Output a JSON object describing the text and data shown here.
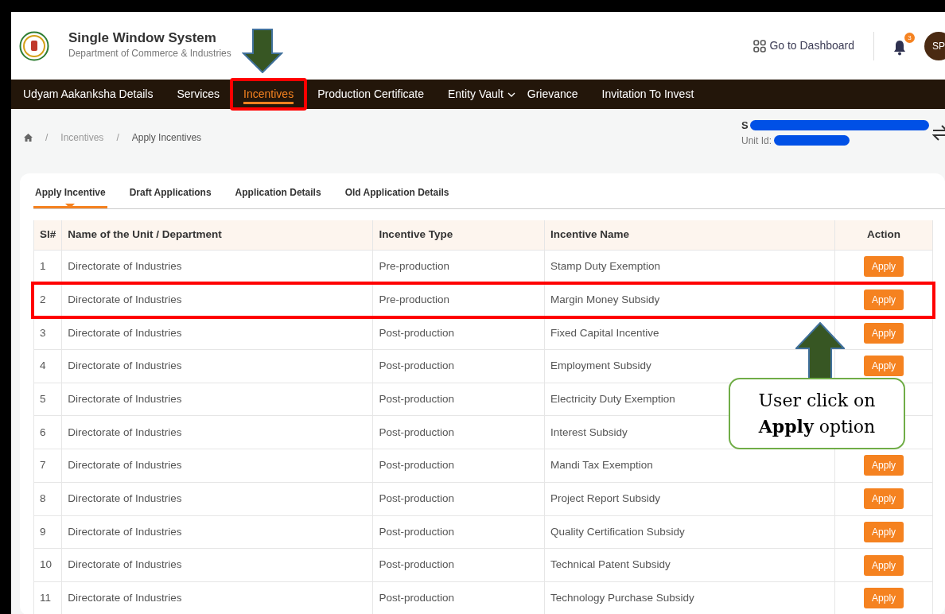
{
  "header": {
    "title": "Single Window System",
    "subtitle": "Department of Commerce & Industries",
    "dashboard_link": "Go to Dashboard",
    "notification_count": "3",
    "avatar": "SP"
  },
  "nav": [
    {
      "label": "Udyam Aakanksha Details",
      "selected": false,
      "highlighted": false,
      "dropdown": false
    },
    {
      "label": "Services",
      "selected": false,
      "highlighted": false,
      "dropdown": false
    },
    {
      "label": "Incentives",
      "selected": true,
      "highlighted": true,
      "dropdown": false
    },
    {
      "label": "Production Certificate",
      "selected": false,
      "highlighted": false,
      "dropdown": false
    },
    {
      "label": "Entity Vault",
      "selected": false,
      "highlighted": false,
      "dropdown": true
    },
    {
      "label": "Grievance",
      "selected": false,
      "highlighted": false,
      "dropdown": false
    },
    {
      "label": "Invitation To Invest",
      "selected": false,
      "highlighted": false,
      "dropdown": false
    }
  ],
  "breadcrumb": [
    {
      "separator": "/",
      "label": "Incentives"
    },
    {
      "separator": "/",
      "label": "Apply Incentives"
    }
  ],
  "unit": {
    "name": "S",
    "id_label": "Unit Id:"
  },
  "tabs": [
    {
      "label": "Apply Incentive",
      "selected": true
    },
    {
      "label": "Draft Applications",
      "selected": false
    },
    {
      "label": "Application Details",
      "selected": false
    },
    {
      "label": "Old Application Details",
      "selected": false
    }
  ],
  "table": {
    "columns": [
      "Sl#",
      "Name of the Unit / Department",
      "Incentive Type",
      "Incentive Name",
      "Action"
    ],
    "rows": [
      {
        "sl": "1",
        "unit": "Directorate of Industries",
        "type": "Pre-production",
        "name": "Stamp Duty Exemption",
        "action": "Apply",
        "highlighted": false
      },
      {
        "sl": "2",
        "unit": "Directorate of Industries",
        "type": "Pre-production",
        "name": "Margin Money Subsidy",
        "action": "Apply",
        "highlighted": true
      },
      {
        "sl": "3",
        "unit": "Directorate of Industries",
        "type": "Post-production",
        "name": "Fixed Capital Incentive",
        "action": "Apply",
        "highlighted": false
      },
      {
        "sl": "4",
        "unit": "Directorate of Industries",
        "type": "Post-production",
        "name": "Employment Subsidy",
        "action": "Apply",
        "highlighted": false
      },
      {
        "sl": "5",
        "unit": "Directorate of Industries",
        "type": "Post-production",
        "name": "Electricity Duty Exemption",
        "highlighted": false
      },
      {
        "sl": "6",
        "unit": "Directorate of Industries",
        "type": "Post-production",
        "name": "Interest Subsidy",
        "highlighted": false
      },
      {
        "sl": "7",
        "unit": "Directorate of Industries",
        "type": "Post-production",
        "name": "Mandi Tax Exemption",
        "action": "Apply",
        "highlighted": false
      },
      {
        "sl": "8",
        "unit": "Directorate of Industries",
        "type": "Post-production",
        "name": "Project Report Subsidy",
        "action": "Apply",
        "highlighted": false
      },
      {
        "sl": "9",
        "unit": "Directorate of Industries",
        "type": "Post-production",
        "name": "Quality Certification Subsidy",
        "action": "Apply",
        "highlighted": false
      },
      {
        "sl": "10",
        "unit": "Directorate of Industries",
        "type": "Post-production",
        "name": "Technical Patent Subsidy",
        "action": "Apply",
        "highlighted": false
      },
      {
        "sl": "11",
        "unit": "Directorate of Industries",
        "type": "Post-production",
        "name": "Technology Purchase Subsidy",
        "action": "Apply",
        "highlighted": false
      }
    ]
  },
  "callout": {
    "text": "User click on **Apply** option"
  }
}
